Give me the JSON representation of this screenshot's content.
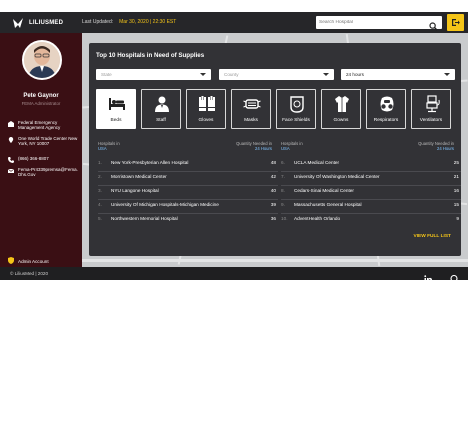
{
  "app": {
    "name": "LILIUSMED"
  },
  "topbar": {
    "updated_label": "Last Updated:",
    "updated_value": "Mar 30, 2020 | 22:30 EST",
    "search_placeholder": "Search Hospital"
  },
  "sidebar": {
    "user_name": "Pete Gaynor",
    "user_role": "FEMA Administrator",
    "info": [
      {
        "icon": "building-icon",
        "text": "Federal Emergency Management Agency"
      },
      {
        "icon": "location-pin-icon",
        "text": "One World Trade Center New York, NY 10007"
      },
      {
        "icon": "phone-icon",
        "text": "(866) 366-8807"
      },
      {
        "icon": "email-icon",
        "text": "Fema-Pr4339premsa@Fema.Dhs.Gov"
      }
    ],
    "admin_label": "Admin Account"
  },
  "panel": {
    "title": "Top 10 Hospitals in Need of Supplies",
    "state_placeholder": "State",
    "county_placeholder": "County",
    "time_value": "24 hours",
    "categories": [
      {
        "label": "Beds",
        "icon": "bed-icon",
        "active": true
      },
      {
        "label": "Staff",
        "icon": "staff-icon",
        "active": false
      },
      {
        "label": "Gloves",
        "icon": "gloves-icon",
        "active": false
      },
      {
        "label": "Masks",
        "icon": "mask-icon",
        "active": false
      },
      {
        "label": "Face Shields",
        "icon": "face-shield-icon",
        "active": false
      },
      {
        "label": "Gowns",
        "icon": "gown-icon",
        "active": false
      },
      {
        "label": "Respirators",
        "icon": "respirator-icon",
        "active": false
      },
      {
        "label": "Ventilators",
        "icon": "ventilator-icon",
        "active": false
      }
    ],
    "col_left_label": "Hospitals in",
    "col_left_region": "USA",
    "col_qty_label": "Quantity Needed in",
    "col_qty_period": "24 Hours",
    "left_rows": [
      {
        "rank": "1.",
        "name": "New York-Presbyterian Allen Hospital",
        "qty": "48"
      },
      {
        "rank": "2.",
        "name": "Morristown Medical Center",
        "qty": "42"
      },
      {
        "rank": "3.",
        "name": "NYU Langone Hospital",
        "qty": "40"
      },
      {
        "rank": "4.",
        "name": "University Of Michigan Hospitals-Michigan Medicine",
        "qty": "39"
      },
      {
        "rank": "5.",
        "name": "Northwestern Memorial Hospital",
        "qty": "36"
      }
    ],
    "right_rows": [
      {
        "rank": "6.",
        "name": "UCLA Medical Center",
        "qty": "25"
      },
      {
        "rank": "7.",
        "name": "University Of Washington Medical Center",
        "qty": "21"
      },
      {
        "rank": "8.",
        "name": "Cedars-Sinai Medical Center",
        "qty": "16"
      },
      {
        "rank": "9.",
        "name": "Massachusetts General Hospital",
        "qty": "15"
      },
      {
        "rank": "10.",
        "name": "AdventHealth Orlando",
        "qty": "9"
      }
    ],
    "view_full_label": "VIEW FULL LIST"
  },
  "footer": {
    "copyright": "© LiliusMed | 2020"
  },
  "colors": {
    "accent": "#f5c518",
    "sidebar_bg": "#3a0f14",
    "link_blue": "#7fc3ff"
  }
}
